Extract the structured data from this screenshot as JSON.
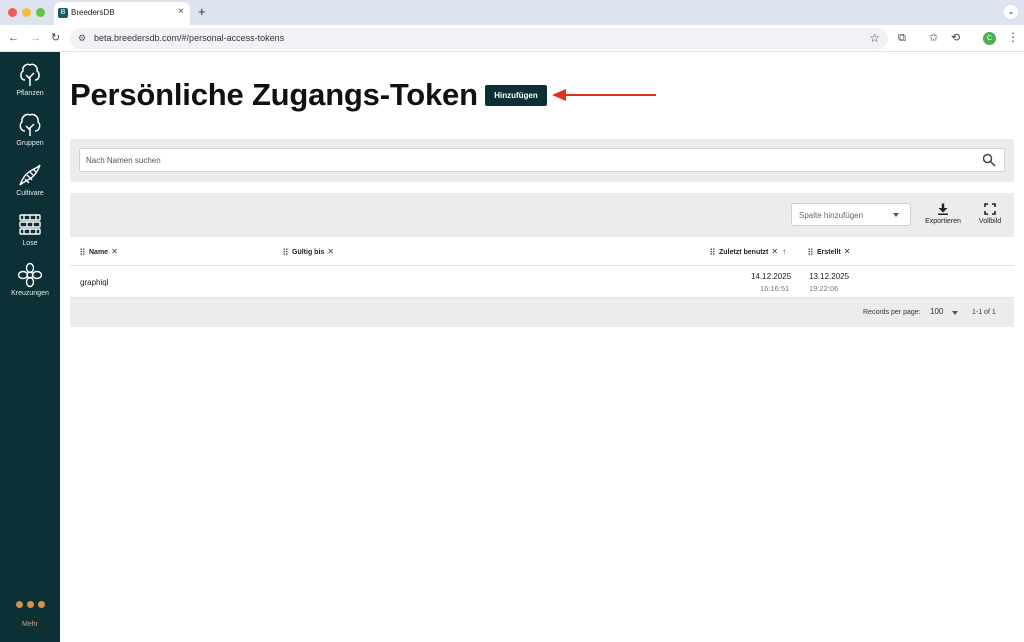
{
  "browser": {
    "tab_title": "BreedersDB",
    "favicon_letter": "B",
    "url": "beta.breedersdb.com/#/personal-access-tokens",
    "new_tab": "+",
    "tab_close": "×",
    "profile_initial": "C"
  },
  "sidebar": {
    "items": [
      {
        "label": "Pflanzen",
        "icon": "tree-icon"
      },
      {
        "label": "Gruppen",
        "icon": "trees-icon"
      },
      {
        "label": "Cultivare",
        "icon": "dna-icon"
      },
      {
        "label": "Lose",
        "icon": "lots-icon"
      },
      {
        "label": "Kreuzungen",
        "icon": "flower-icon"
      }
    ],
    "more_label": "Mehr",
    "more_color": "#d98f4e",
    "bg_color": "#0c3036"
  },
  "main": {
    "title": "Persönliche Zugangs-Token",
    "add_button": "Hinzufügen",
    "annotation_arrow_color": "#e0321c",
    "search_placeholder": "Nach Namen suchen"
  },
  "table": {
    "column_select_placeholder": "Spalte hinzufügen",
    "export_label": "Exportieren",
    "fullscreen_label": "Vollbild",
    "columns": [
      "Name",
      "Gültig bis",
      "Zuletzt benutzt",
      "Erstellt"
    ],
    "rows": [
      {
        "name": "graphiql",
        "valid_until": "",
        "last_used_date": "14.12.2025",
        "last_used_time": "16:16:51",
        "created_date": "13.12.2025",
        "created_time": "19:22:06"
      }
    ],
    "records_per_page_label": "Records per page:",
    "records_per_page": "100",
    "range": "1-1 of 1"
  }
}
